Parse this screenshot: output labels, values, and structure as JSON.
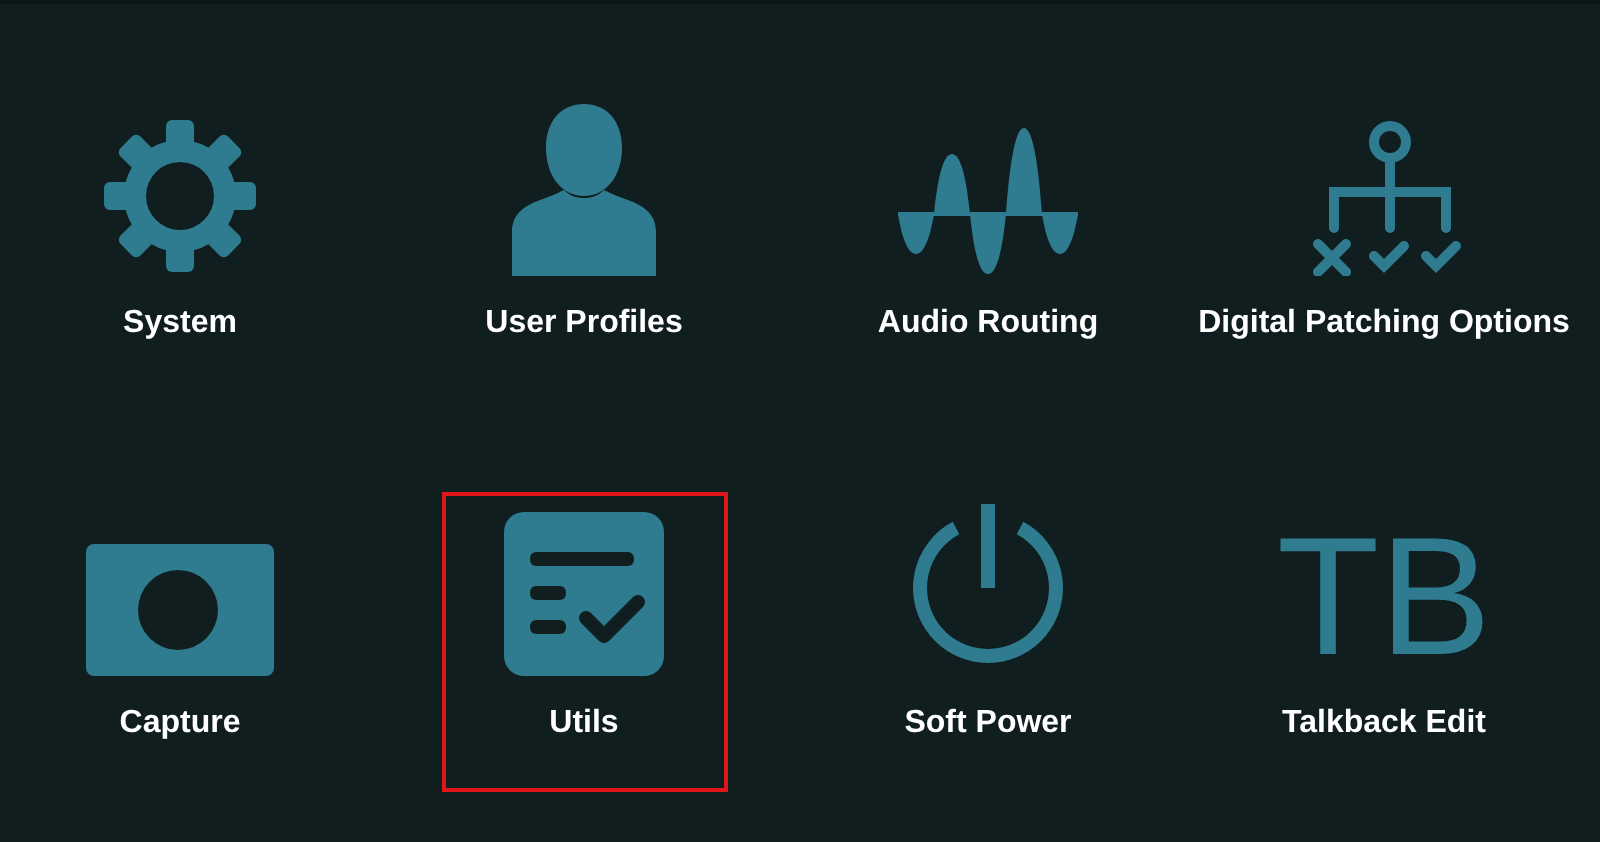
{
  "tiles": [
    {
      "kind": "gear",
      "label": "System",
      "selected": false
    },
    {
      "kind": "user",
      "label": "User Profiles",
      "selected": false
    },
    {
      "kind": "wave",
      "label": "Audio Routing",
      "selected": false
    },
    {
      "kind": "tree",
      "label": "Digital Patching Options",
      "selected": false
    },
    {
      "kind": "camera",
      "label": "Capture",
      "selected": false
    },
    {
      "kind": "checklist",
      "label": "Utils",
      "selected": true
    },
    {
      "kind": "power",
      "label": "Soft Power",
      "selected": false
    },
    {
      "kind": "glyph",
      "glyph": "TB",
      "label": "Talkback Edit",
      "selected": false
    }
  ]
}
